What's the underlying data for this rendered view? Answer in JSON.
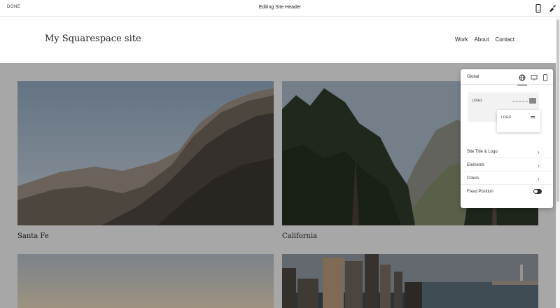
{
  "editor_bar": {
    "left_label": "DONE",
    "center_label": "Editing Site Header",
    "icons": [
      "mobile-preview-icon",
      "style-brush-icon"
    ]
  },
  "site": {
    "title": "My Squarespace site",
    "nav": [
      "Work",
      "About",
      "Contact"
    ]
  },
  "gallery": {
    "items": [
      {
        "caption": "Santa Fe",
        "image": "desert-mountain-photo"
      },
      {
        "caption": "California",
        "image": "forest-mountain-photo"
      },
      {
        "caption": "",
        "image": "sky-gradient-photo"
      },
      {
        "caption": "",
        "image": "city-harbor-photo"
      }
    ]
  },
  "header_panel": {
    "title": "Global",
    "tabs": [
      "globe-icon",
      "desktop-icon",
      "mobile-icon"
    ],
    "active_tab": "globe-icon",
    "layout_logo": "LOGO",
    "layout_card_label": "LOGO",
    "rows": [
      {
        "label": "Site Title & Logo",
        "type": "link"
      },
      {
        "label": "Elements",
        "type": "link"
      },
      {
        "label": "Colors",
        "type": "link"
      },
      {
        "label": "Fixed Position",
        "type": "toggle",
        "value": true
      }
    ]
  }
}
